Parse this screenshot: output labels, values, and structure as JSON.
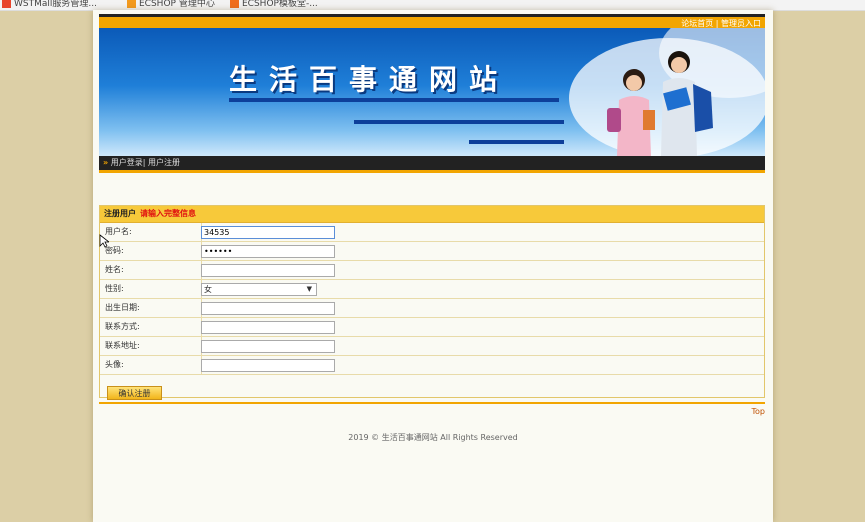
{
  "bookmarks": [
    {
      "label": "WSTMall服务管理..."
    },
    {
      "label": "ECSHOP 管理中心"
    },
    {
      "label": "ECSHOP模板堂-..."
    }
  ],
  "header": {
    "links": [
      "论坛首页",
      "管理员入口"
    ],
    "separator": "|",
    "banner_title": "生活百事通网站"
  },
  "nav": {
    "arrow": "»",
    "items": [
      "用户登录",
      "用户注册"
    ],
    "separator": "|"
  },
  "form": {
    "title": "注册用户",
    "hint": "请输入完整信息",
    "fields": [
      {
        "label": "用户名:",
        "value": "34535",
        "placeholder": ""
      },
      {
        "label": "密码:",
        "value": "••••••",
        "placeholder": ""
      },
      {
        "label": "姓名:",
        "value": "",
        "placeholder": ""
      },
      {
        "label": "性别:",
        "value": "女"
      },
      {
        "label": "出生日期:",
        "value": "",
        "placeholder": ""
      },
      {
        "label": "联系方式:",
        "value": "",
        "placeholder": ""
      },
      {
        "label": "联系地址:",
        "value": "",
        "placeholder": ""
      },
      {
        "label": "头像:",
        "value": "",
        "placeholder": ""
      }
    ],
    "submit_label": "确认注册"
  },
  "top_link": "Top",
  "footer": "2019 © 生活百事通网站 All Rights Reserved",
  "colors": {
    "accent": "#f2a500",
    "header_bar": "#f7c93a",
    "hint": "#e01010"
  }
}
